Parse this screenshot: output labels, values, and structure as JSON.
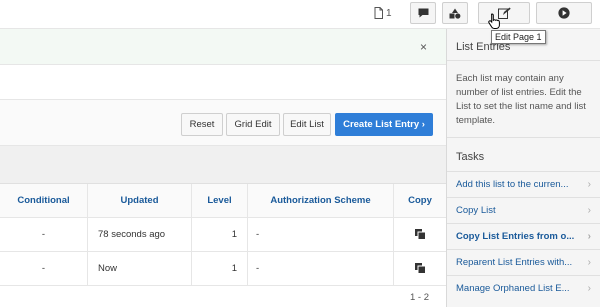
{
  "toolbar": {
    "page_number": "1",
    "tooltip": "Edit Page 1"
  },
  "buttons": {
    "reset": "Reset",
    "grid_edit": "Grid Edit",
    "edit_list": "Edit List",
    "create": "Create List Entry ›"
  },
  "table": {
    "headers": [
      "Conditional",
      "Updated",
      "Level",
      "Authorization Scheme",
      "Copy"
    ],
    "rows": [
      {
        "conditional": "-",
        "updated": "78 seconds ago",
        "level": "1",
        "auth": "-"
      },
      {
        "conditional": "-",
        "updated": "Now",
        "level": "1",
        "auth": "-"
      }
    ],
    "pagination": "1 - 2"
  },
  "panel": {
    "title": "List Entries",
    "description": "Each list may contain any number of list entries. Edit the List to set the list name and list template.",
    "tasks_title": "Tasks",
    "tasks": [
      "Add this list to the curren...",
      "Copy List",
      "Copy List Entries from o...",
      "Reparent List Entries with...",
      "Manage Orphaned List E..."
    ]
  },
  "notification": {
    "close": "×"
  },
  "colors": {
    "primary": "#2f7ed8",
    "link": "#1a5a9a",
    "notification_bg": "#f3f9f4"
  }
}
